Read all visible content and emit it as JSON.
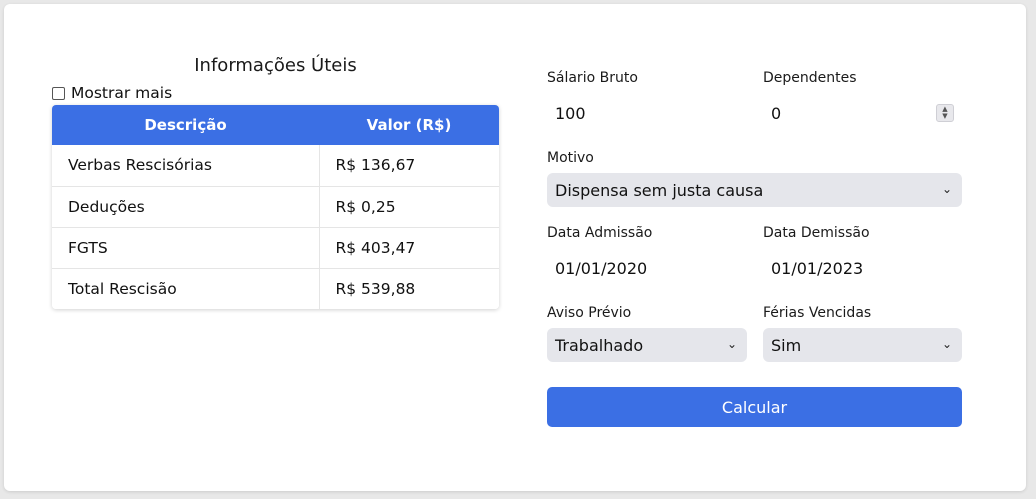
{
  "info": {
    "title": "Informações Úteis",
    "show_more_label": "Mostrar mais",
    "table": {
      "headers": [
        "Descrição",
        "Valor (R$)"
      ],
      "rows": [
        [
          "Verbas Rescisórias",
          "R$ 136,67"
        ],
        [
          "Deduções",
          "R$ 0,25"
        ],
        [
          "FGTS",
          "R$ 403,47"
        ],
        [
          "Total Rescisão",
          "R$ 539,88"
        ]
      ]
    }
  },
  "form": {
    "salario_label": "Sálario Bruto",
    "salario_value": "100",
    "dependentes_label": "Dependentes",
    "dependentes_value": "0",
    "motivo_label": "Motivo",
    "motivo_value": "Dispensa sem justa causa",
    "admissao_label": "Data Admissão",
    "admissao_value": "01/01/2020",
    "demissao_label": "Data Demissão",
    "demissao_value": "01/01/2023",
    "aviso_label": "Aviso Prévio",
    "aviso_value": "Trabalhado",
    "ferias_label": "Férias Vencidas",
    "ferias_value": "Sim",
    "submit_label": "Calcular"
  },
  "colors": {
    "accent": "#3b6fe4",
    "select_bg": "#e5e6eb"
  }
}
